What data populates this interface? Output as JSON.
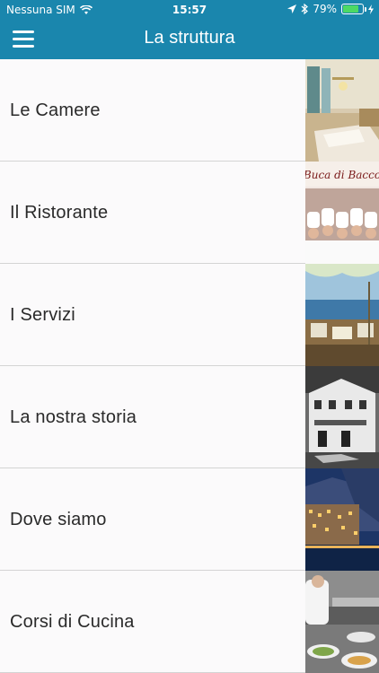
{
  "status_bar": {
    "carrier": "Nessuna SIM",
    "time": "15:57",
    "battery": "79%",
    "battery_level": 0.79
  },
  "navbar": {
    "title": "La struttura",
    "menu_icon": "hamburger-icon"
  },
  "rows": [
    {
      "label": "Le Camere",
      "image": "hotel-room-photo"
    },
    {
      "label": "Il Ristorante",
      "image": "chefs-team-photo",
      "image_text": "Buca di Bacco"
    },
    {
      "label": "I Servizi",
      "image": "terrace-sea-view-photo"
    },
    {
      "label": "La nostra storia",
      "image": "historic-building-bw-photo"
    },
    {
      "label": "Dove siamo",
      "image": "positano-night-photo"
    },
    {
      "label": "Corsi di Cucina",
      "image": "cooking-class-photo"
    }
  ]
}
